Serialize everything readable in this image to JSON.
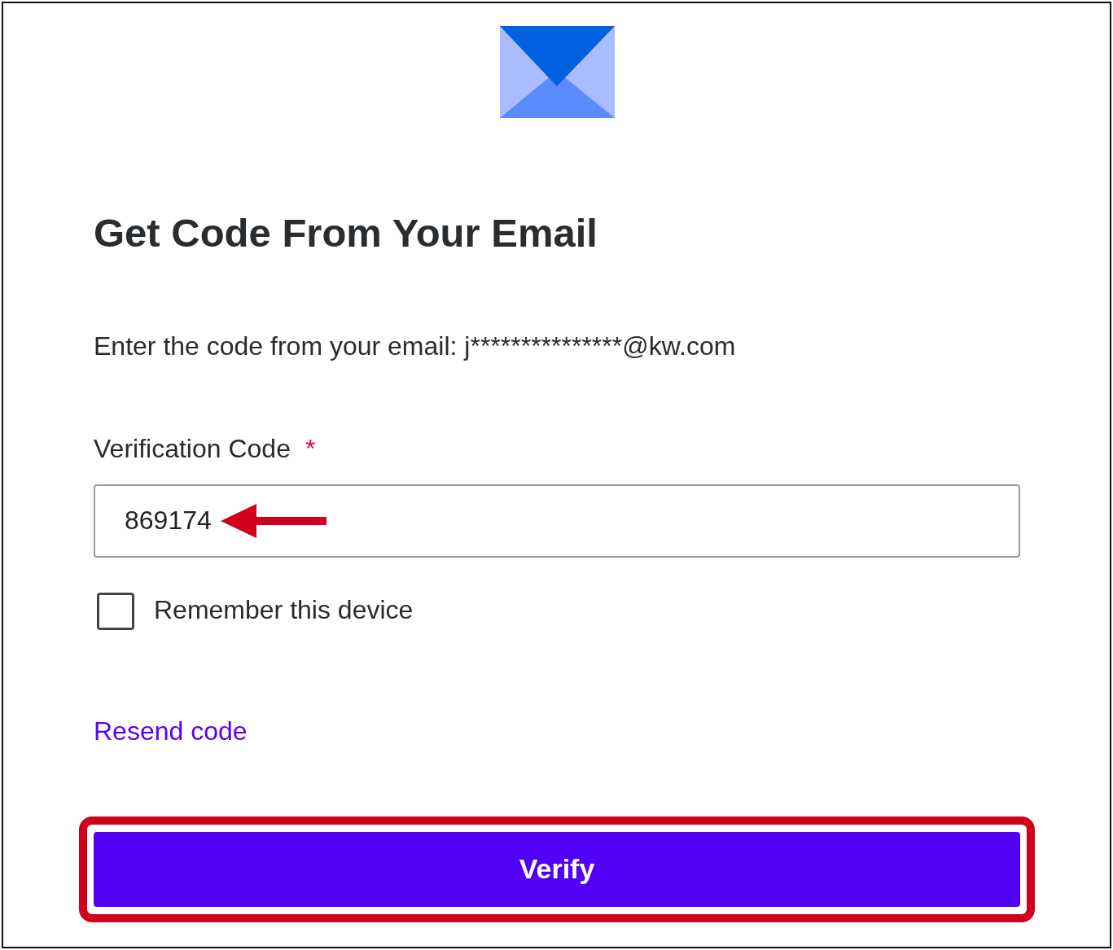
{
  "title": "Get Code From Your Email",
  "prompt": "Enter the code from your email: j***************@kw.com",
  "field": {
    "label": "Verification Code",
    "required_marker": "*",
    "value": "869174"
  },
  "checkbox": {
    "label": "Remember this device",
    "checked": false
  },
  "resend_link": "Resend code",
  "button": "Verify",
  "annotations": {
    "arrow_on_field": true,
    "highlight_button": true
  }
}
